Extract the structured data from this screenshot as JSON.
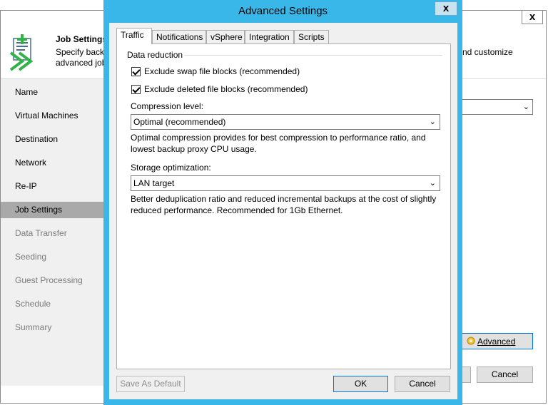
{
  "background_window": {
    "header": {
      "title": "Job Settings",
      "description_line1": "Specify back",
      "description_line2": "advanced job",
      "description_right": "nd customize"
    },
    "sidebar_items": [
      {
        "label": "Name",
        "state": "normal"
      },
      {
        "label": "Virtual Machines",
        "state": "normal"
      },
      {
        "label": "Destination",
        "state": "normal"
      },
      {
        "label": "Network",
        "state": "normal"
      },
      {
        "label": "Re-IP",
        "state": "normal"
      },
      {
        "label": "Job Settings",
        "state": "selected"
      },
      {
        "label": "Data Transfer",
        "state": "dim"
      },
      {
        "label": "Seeding",
        "state": "dim"
      },
      {
        "label": "Guest Processing",
        "state": "dim"
      },
      {
        "label": "Schedule",
        "state": "dim"
      },
      {
        "label": "Summary",
        "state": "dim"
      }
    ],
    "advanced_button": "Advanced",
    "cancel_button": "Cancel",
    "close_glyph": "x"
  },
  "dialog": {
    "title": "Advanced Settings",
    "close_glyph": "x",
    "tabs": [
      "Traffic",
      "Notifications",
      "vSphere",
      "Integration",
      "Scripts"
    ],
    "active_tab": "Traffic",
    "data_reduction": {
      "group_label": "Data reduction",
      "exclude_swap": {
        "label": "Exclude swap file blocks (recommended)",
        "checked": true
      },
      "exclude_deleted": {
        "label": "Exclude deleted file blocks (recommended)",
        "checked": true
      }
    },
    "compression": {
      "label": "Compression level:",
      "value": "Optimal (recommended)",
      "help_line1": "Optimal compression provides for best compression to performance ratio, and",
      "help_line2": "lowest backup proxy CPU usage."
    },
    "storage": {
      "label": "Storage optimization:",
      "value": "LAN target",
      "help_line1": "Better deduplication ratio and reduced incremental backups at the cost of slightly",
      "help_line2": "reduced performance. Recommended for 1Gb Ethernet."
    },
    "buttons": {
      "save_default": "Save As Default",
      "ok": "OK",
      "cancel": "Cancel"
    }
  },
  "colors": {
    "dialog_frame": "#39b7e8",
    "sidebar_bg": "#f0f0f0",
    "selected_nav": "#a9a9a9",
    "default_button_border": "#0078d7"
  }
}
